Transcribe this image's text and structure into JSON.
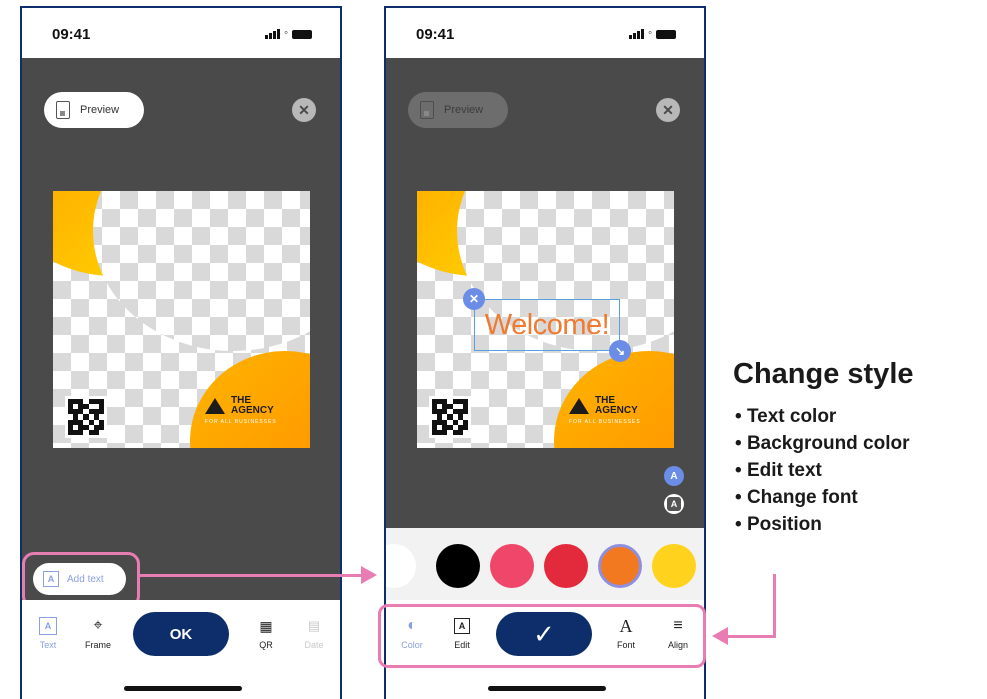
{
  "status": {
    "time": "09:41"
  },
  "left_phone": {
    "preview_label": "Preview",
    "add_text_label": "Add text",
    "toolbar": [
      {
        "label": "Text",
        "icon": "text-box-icon",
        "state": "active"
      },
      {
        "label": "Frame",
        "icon": "crop-icon",
        "state": "normal"
      },
      {
        "label": "QR",
        "icon": "qr-icon",
        "state": "normal"
      },
      {
        "label": "Date",
        "icon": "calendar-icon",
        "state": "disabled"
      }
    ],
    "ok_label": "OK"
  },
  "right_phone": {
    "preview_label": "Preview",
    "welcome_text": "Welcome!",
    "side_buttons": [
      "A",
      "A"
    ],
    "swatches": [
      "#ffffff",
      "#000000",
      "#f0466a",
      "#e22a3c",
      "#f37920",
      "#ffd21e"
    ],
    "selected_swatch": "#f37920",
    "toolbar": [
      {
        "label": "Color",
        "icon": "palette-icon",
        "state": "active"
      },
      {
        "label": "Edit",
        "icon": "edit-text-icon",
        "state": "normal"
      },
      {
        "label": "Font",
        "icon": "font-icon",
        "state": "normal"
      },
      {
        "label": "Align",
        "icon": "align-icon",
        "state": "normal"
      }
    ]
  },
  "frame_template": {
    "brand_name_line1": "THE",
    "brand_name_line2": "AGENCY",
    "tagline": "FOR ALL BUSINESSES"
  },
  "annotation": {
    "title": "Change style",
    "items": [
      "Text color",
      "Background color",
      "Edit text",
      "Change font",
      "Position"
    ]
  },
  "colors": {
    "navy": "#0d2d6b",
    "pink_highlight": "#e87db4",
    "canvas_bg": "#4a4a4a",
    "accent_blue": "#8aa0e0"
  }
}
